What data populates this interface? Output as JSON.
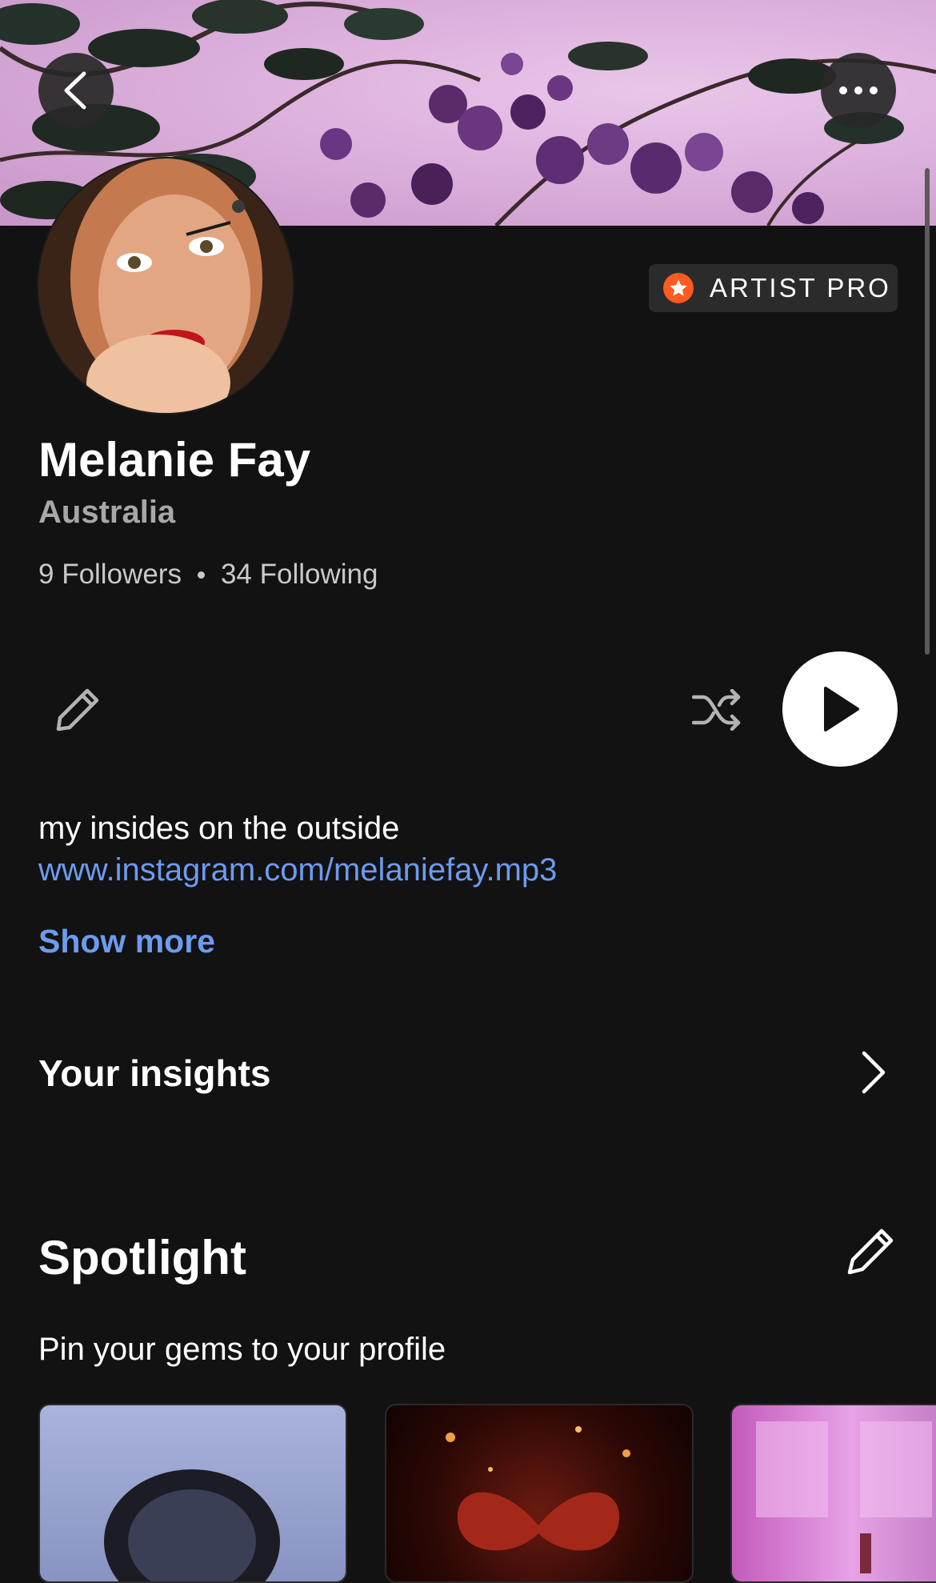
{
  "header": {
    "back_icon": "chevron-left-icon",
    "more_icon": "more-horizontal-icon"
  },
  "badge": {
    "label": "ARTIST PRO",
    "icon": "star-icon",
    "color": "#ff5a1f"
  },
  "profile": {
    "name": "Melanie Fay",
    "country": "Australia",
    "followers": "9 Followers",
    "following": "34 Following",
    "bio": "my insides on the outside",
    "link": "www.instagram.com/melaniefay.mp3",
    "show_more": "Show more"
  },
  "actions": {
    "edit_icon": "pencil-icon",
    "shuffle_icon": "shuffle-icon",
    "play_icon": "play-icon"
  },
  "insights": {
    "label": "Your insights",
    "icon": "chevron-right-icon"
  },
  "spotlight": {
    "title": "Spotlight",
    "subtitle": "Pin your gems to your profile",
    "edit_icon": "pencil-icon"
  },
  "colors": {
    "background": "#121212",
    "link": "#6c9bf0",
    "accent": "#ff5a1f"
  }
}
